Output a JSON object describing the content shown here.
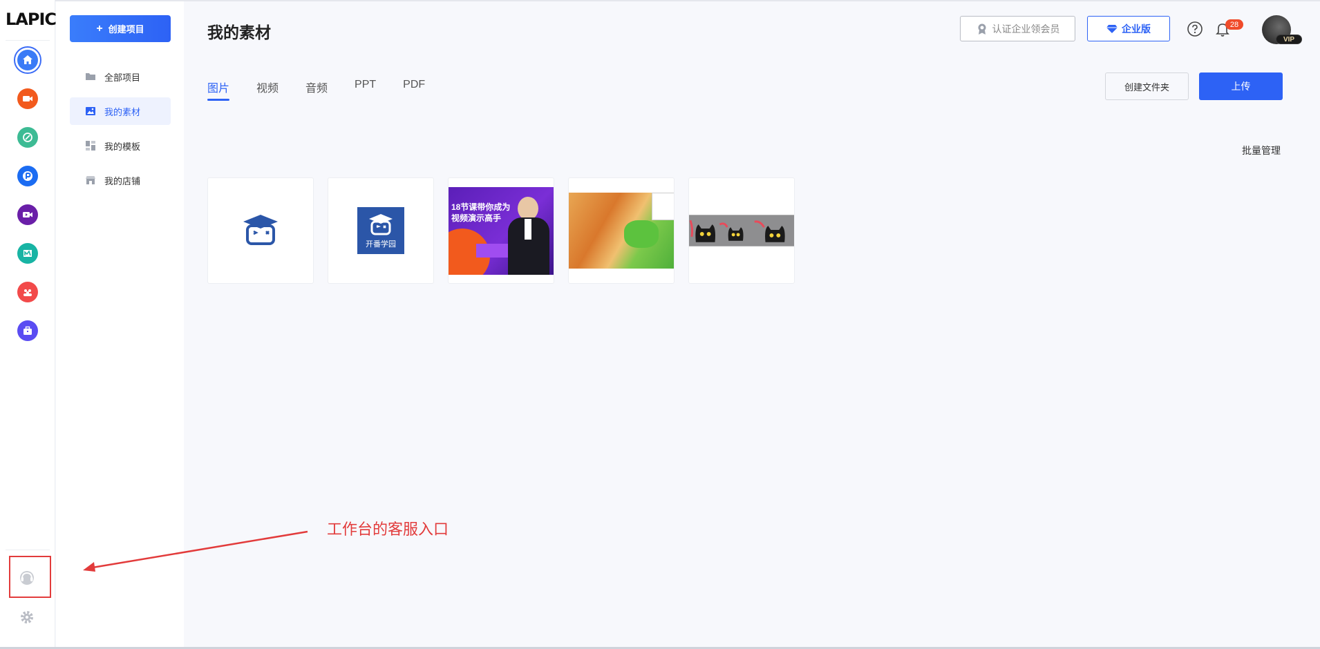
{
  "app": {
    "logo_text": "LAPIC",
    "brand_color": "#2d62f5"
  },
  "rail": {
    "items": [
      {
        "name": "home-icon",
        "color": "#3b7bf6"
      },
      {
        "name": "video-camera-icon",
        "color": "#f25a1d"
      },
      {
        "name": "leaf-icon",
        "color": "#3dbb94"
      },
      {
        "name": "p-letter-icon",
        "color": "#1b6cf2"
      },
      {
        "name": "video-play-icon",
        "color": "#6a1fa8"
      },
      {
        "name": "chart-icon",
        "color": "#18b4a4"
      },
      {
        "name": "people-icon",
        "color": "#f24a4a"
      },
      {
        "name": "toolbox-icon",
        "color": "#5a4cf2"
      }
    ]
  },
  "sidebar": {
    "create_label": "创建项目",
    "items": [
      {
        "label": "全部项目"
      },
      {
        "label": "我的素材"
      },
      {
        "label": "我的模板"
      },
      {
        "label": "我的店铺"
      }
    ]
  },
  "header": {
    "title": "我的素材",
    "cert_label": "认证企业领会员",
    "enterprise_label": "企业版",
    "notification_count": "28",
    "vip_label": "VIP"
  },
  "tabs": [
    {
      "label": "图片"
    },
    {
      "label": "视频"
    },
    {
      "label": "音频"
    },
    {
      "label": "PPT"
    },
    {
      "label": "PDF"
    }
  ],
  "toolbar": {
    "create_folder_label": "创建文件夹",
    "upload_label": "上传",
    "batch_label": "批量管理"
  },
  "thumbnails": {
    "t2_caption": "开番学园",
    "t3_line1": "18节课带你成为",
    "t3_line2": "视频演示高手"
  },
  "annotation": {
    "text": "工作台的客服入口",
    "color": "#e23b3b"
  }
}
